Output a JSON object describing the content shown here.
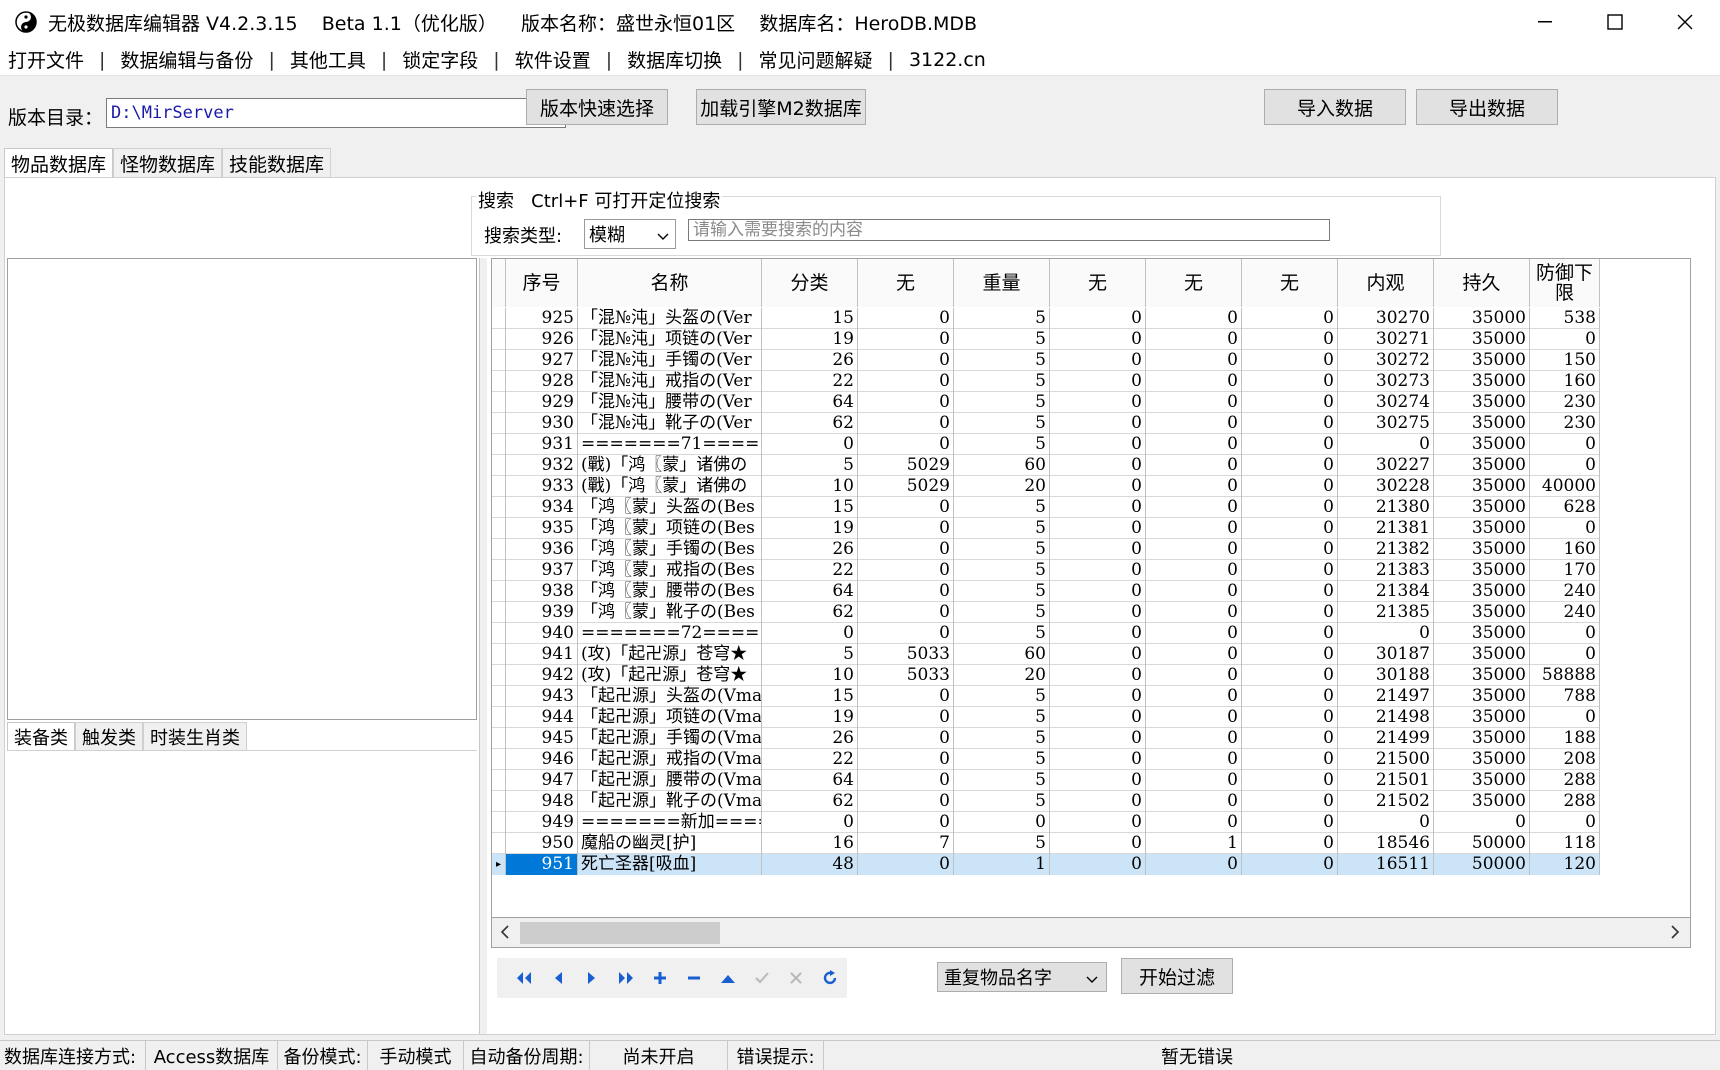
{
  "window": {
    "title": "无极数据库编辑器 V4.2.3.15    Beta 1.1（优化版）    版本名称：盛世永恒01区    数据库名：HeroDB.MDB"
  },
  "menu": [
    "打开文件",
    "数据编辑与备份",
    "其他工具",
    "锁定字段",
    "软件设置",
    "数据库切换",
    "常见问题解疑",
    "3122.cn"
  ],
  "toolbar": {
    "dir_label": "版本目录：",
    "dir_value": "D:\\MirServer",
    "quick_select": "版本快速选择",
    "load_m2": "加载引擎M2数据库",
    "import": "导入数据",
    "export": "导出数据"
  },
  "main_tabs": [
    "物品数据库",
    "怪物数据库",
    "技能数据库"
  ],
  "search": {
    "legend": "搜索   Ctrl+F 可打开定位搜索",
    "type_label": "搜索类型:",
    "type_value": "模糊",
    "placeholder": "请输入需要搜索的内容"
  },
  "sub_tabs": [
    "装备类",
    "触发类",
    "时装生肖类"
  ],
  "grid": {
    "headers": [
      "序号",
      "名称",
      "分类",
      "无",
      "重量",
      "无",
      "无",
      "无",
      "内观",
      "持久",
      "防御下限"
    ],
    "rows": [
      [
        "925",
        "「混№沌」头盔の(Ver",
        "15",
        "0",
        "5",
        "0",
        "0",
        "0",
        "30270",
        "35000",
        "538"
      ],
      [
        "926",
        "「混№沌」项链の(Ver",
        "19",
        "0",
        "5",
        "0",
        "0",
        "0",
        "30271",
        "35000",
        "0"
      ],
      [
        "927",
        "「混№沌」手镯の(Ver",
        "26",
        "0",
        "5",
        "0",
        "0",
        "0",
        "30272",
        "35000",
        "150"
      ],
      [
        "928",
        "「混№沌」戒指の(Ver",
        "22",
        "0",
        "5",
        "0",
        "0",
        "0",
        "30273",
        "35000",
        "160"
      ],
      [
        "929",
        "「混№沌」腰带の(Ver",
        "64",
        "0",
        "5",
        "0",
        "0",
        "0",
        "30274",
        "35000",
        "230"
      ],
      [
        "930",
        "「混№沌」靴子の(Ver",
        "62",
        "0",
        "5",
        "0",
        "0",
        "0",
        "30275",
        "35000",
        "230"
      ],
      [
        "931",
        "=======71=======",
        "0",
        "0",
        "5",
        "0",
        "0",
        "0",
        "0",
        "35000",
        "0"
      ],
      [
        "932",
        "(戰)「鸿〖蒙」诸佛の",
        "5",
        "5029",
        "60",
        "0",
        "0",
        "0",
        "30227",
        "35000",
        "0"
      ],
      [
        "933",
        "(戰)「鸿〖蒙」诸佛の",
        "10",
        "5029",
        "20",
        "0",
        "0",
        "0",
        "30228",
        "35000",
        "40000"
      ],
      [
        "934",
        "「鸿〖蒙」头盔の(Bes",
        "15",
        "0",
        "5",
        "0",
        "0",
        "0",
        "21380",
        "35000",
        "628"
      ],
      [
        "935",
        "「鸿〖蒙」项链の(Bes",
        "19",
        "0",
        "5",
        "0",
        "0",
        "0",
        "21381",
        "35000",
        "0"
      ],
      [
        "936",
        "「鸿〖蒙」手镯の(Bes",
        "26",
        "0",
        "5",
        "0",
        "0",
        "0",
        "21382",
        "35000",
        "160"
      ],
      [
        "937",
        "「鸿〖蒙」戒指の(Bes",
        "22",
        "0",
        "5",
        "0",
        "0",
        "0",
        "21383",
        "35000",
        "170"
      ],
      [
        "938",
        "「鸿〖蒙」腰带の(Bes",
        "64",
        "0",
        "5",
        "0",
        "0",
        "0",
        "21384",
        "35000",
        "240"
      ],
      [
        "939",
        "「鸿〖蒙」靴子の(Bes",
        "62",
        "0",
        "5",
        "0",
        "0",
        "0",
        "21385",
        "35000",
        "240"
      ],
      [
        "940",
        "=======72=======",
        "0",
        "0",
        "5",
        "0",
        "0",
        "0",
        "0",
        "35000",
        "0"
      ],
      [
        "941",
        "(攻)「起卍源」苍穹★",
        "5",
        "5033",
        "60",
        "0",
        "0",
        "0",
        "30187",
        "35000",
        "0"
      ],
      [
        "942",
        "(攻)「起卍源」苍穹★",
        "10",
        "5033",
        "20",
        "0",
        "0",
        "0",
        "30188",
        "35000",
        "58888"
      ],
      [
        "943",
        "「起卍源」头盔の(Vma",
        "15",
        "0",
        "5",
        "0",
        "0",
        "0",
        "21497",
        "35000",
        "788"
      ],
      [
        "944",
        "「起卍源」项链の(Vma",
        "19",
        "0",
        "5",
        "0",
        "0",
        "0",
        "21498",
        "35000",
        "0"
      ],
      [
        "945",
        "「起卍源」手镯の(Vma",
        "26",
        "0",
        "5",
        "0",
        "0",
        "0",
        "21499",
        "35000",
        "188"
      ],
      [
        "946",
        "「起卍源」戒指の(Vma",
        "22",
        "0",
        "5",
        "0",
        "0",
        "0",
        "21500",
        "35000",
        "208"
      ],
      [
        "947",
        "「起卍源」腰带の(Vma",
        "64",
        "0",
        "5",
        "0",
        "0",
        "0",
        "21501",
        "35000",
        "288"
      ],
      [
        "948",
        "「起卍源」靴子の(Vma",
        "62",
        "0",
        "5",
        "0",
        "0",
        "0",
        "21502",
        "35000",
        "288"
      ],
      [
        "949",
        "=======新加=======",
        "0",
        "0",
        "0",
        "0",
        "0",
        "0",
        "0",
        "0",
        "0"
      ],
      [
        "950",
        "魔船の幽灵[护]",
        "16",
        "7",
        "5",
        "0",
        "1",
        "0",
        "18546",
        "50000",
        "118"
      ],
      [
        "951",
        "死亡圣器[吸血]",
        "48",
        "0",
        "1",
        "0",
        "0",
        "0",
        "16511",
        "50000",
        "120"
      ]
    ],
    "selected_row": "951"
  },
  "nav_icons": [
    "first-icon",
    "prior-icon",
    "next-icon",
    "last-icon",
    "insert-icon",
    "delete-icon",
    "edit-icon",
    "post-icon",
    "cancel-icon",
    "refresh-icon"
  ],
  "filter": {
    "select_value": "重复物品名字",
    "button": "开始过滤"
  },
  "status": {
    "conn_label": "数据库连接方式:",
    "conn_value": "Access数据库",
    "backup_label": "备份模式:",
    "backup_value": "手动模式",
    "period_label": "自动备份周期:",
    "period_value": "尚未开启",
    "error_label": "错误提示:",
    "error_value": "暂无错误"
  },
  "colors": {
    "selection": "#0078d7",
    "selected_row": "#cce4f7",
    "nav_icon": "#1a5fd1"
  }
}
